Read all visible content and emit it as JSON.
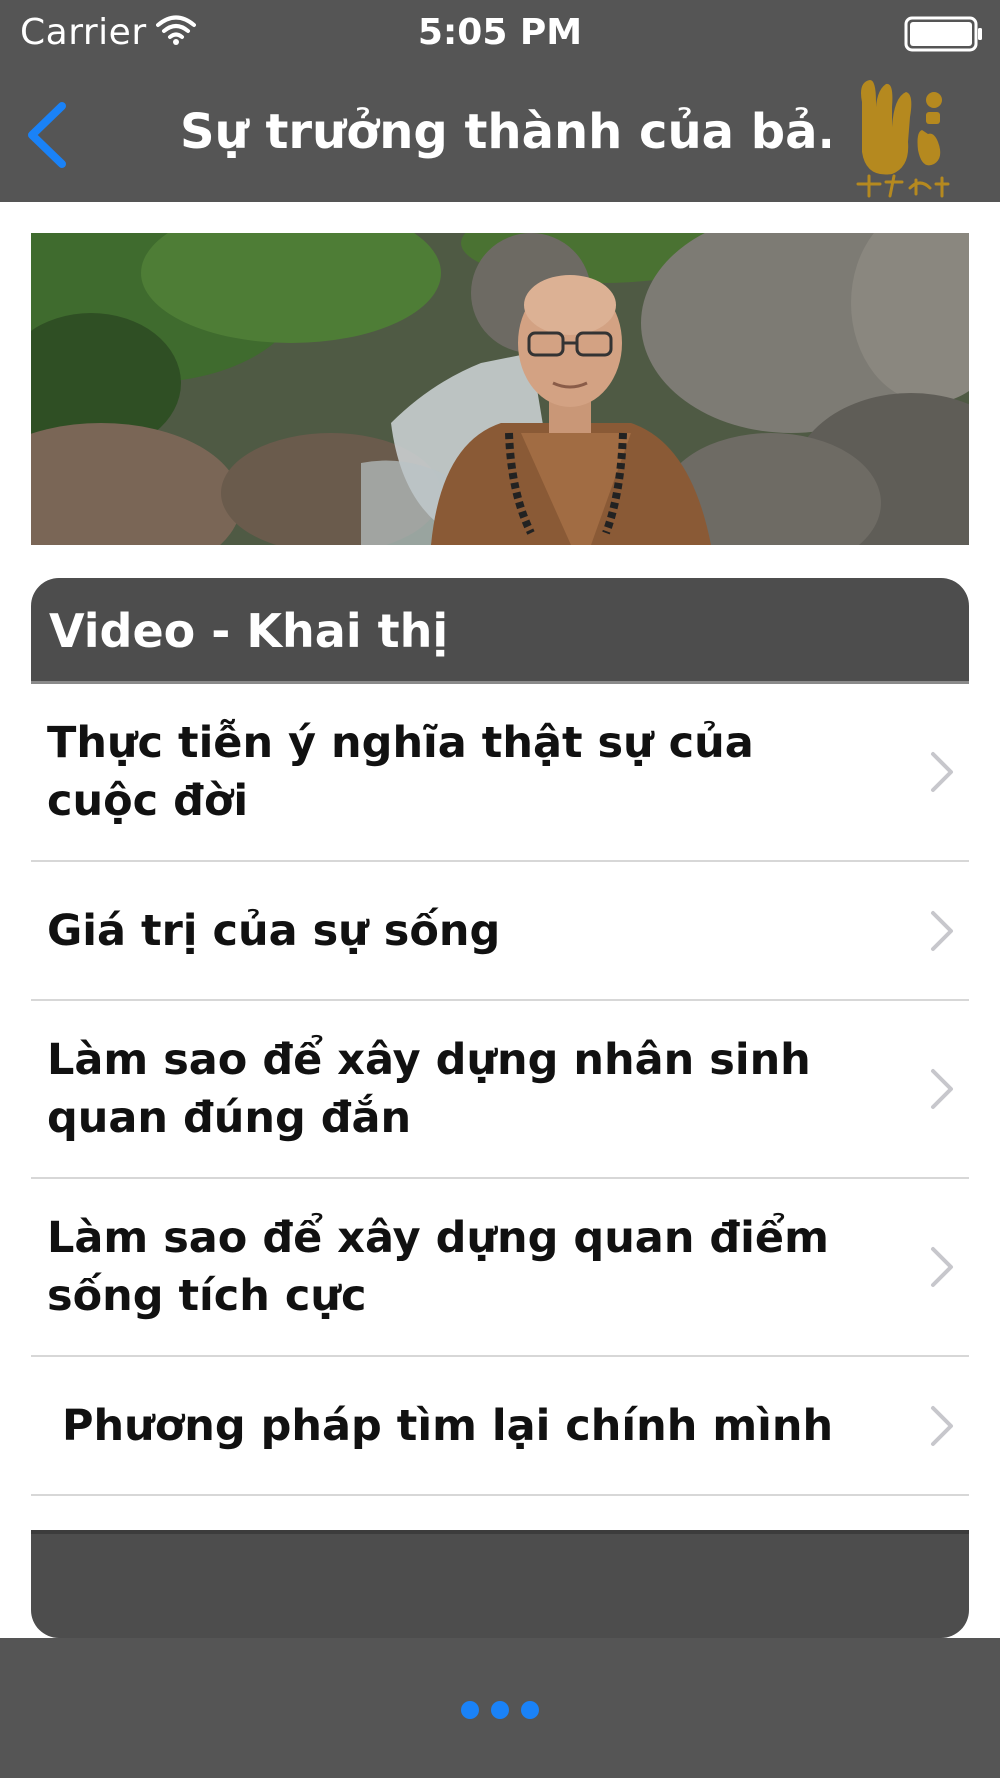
{
  "status_bar": {
    "carrier": "Carrier",
    "time": "5:05 PM"
  },
  "nav": {
    "title": "Sự trưởng thành của bả...",
    "accent_color": "#1a82f7",
    "logo_color": "#b5891f"
  },
  "section": {
    "title": "Video - Khai thị"
  },
  "items": [
    {
      "label": "Thực tiễn ý nghĩa thật sự của cuộc đời"
    },
    {
      "label": "Giá trị của sự sống"
    },
    {
      "label": "Làm sao để xây dựng nhân sinh quan đúng đắn"
    },
    {
      "label": "Làm sao để xây dựng quan điểm sống tích cực"
    },
    {
      "label": " Phương pháp tìm lại chính mình"
    }
  ],
  "icons": {
    "back": "chevron-left-icon",
    "row": "chevron-right-icon",
    "pager": "ellipsis-dots-icon"
  }
}
